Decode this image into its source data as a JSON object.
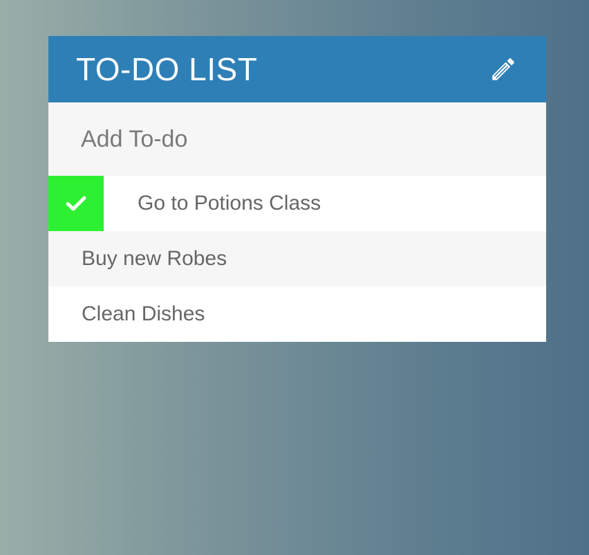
{
  "header": {
    "title": "TO-DO LIST",
    "edit_icon": "pencil-icon",
    "background_color": "#2e7fb6"
  },
  "add_todo": {
    "placeholder": "Add To-do",
    "value": ""
  },
  "todos": [
    {
      "label": "Go to Potions Class",
      "completed": true,
      "check_icon": "checkmark-icon",
      "check_color": "#2ef032"
    },
    {
      "label": "Buy new Robes",
      "completed": false
    },
    {
      "label": "Clean Dishes",
      "completed": false
    }
  ]
}
